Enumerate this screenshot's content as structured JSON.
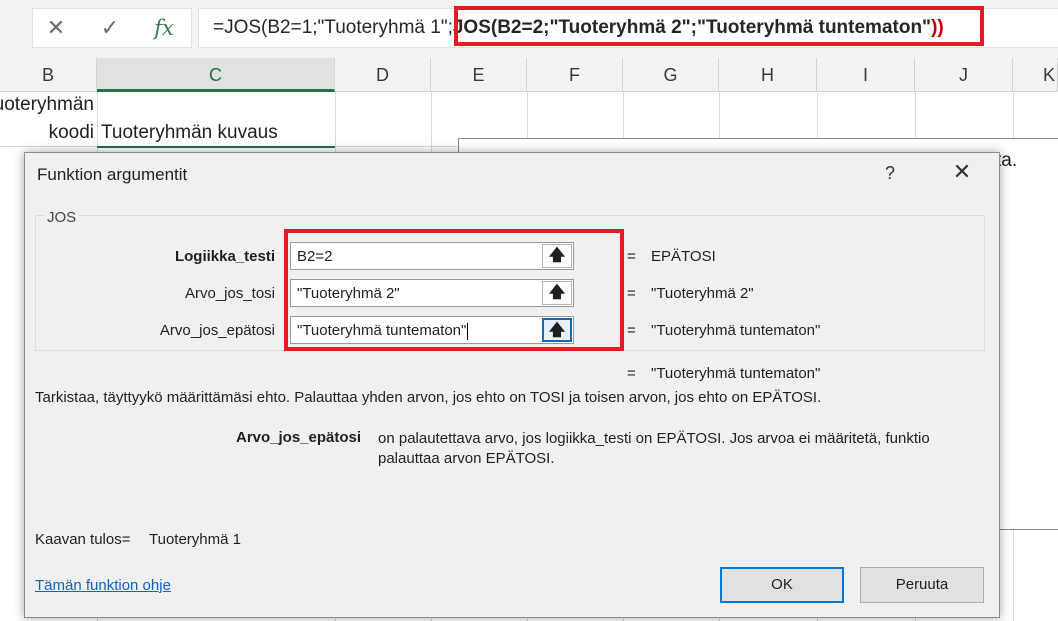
{
  "formula_bar": {
    "cancel_icon": "✕",
    "enter_icon": "✓",
    "fx_label": "fx",
    "formula_start": "=JOS(B2=1;\"Tuoteryhmä 1",
    "formula_highlight_prefix": "\";",
    "formula_highlight_bold": "JOS(B2=2;\"Tuoteryhmä 2\";\"Tuoteryhmä tuntematon\"",
    "formula_highlight_close": "))"
  },
  "sheet": {
    "columns": [
      "B",
      "C",
      "D",
      "E",
      "F",
      "G",
      "H",
      "I",
      "J",
      "K"
    ],
    "selected_column": "C",
    "cells": {
      "b1_line1": "Tuoteryhmän",
      "b1_line2": "koodi",
      "c1": "Tuoteryhmän kuvaus"
    },
    "textbox_fragment": "ta."
  },
  "dialog": {
    "title": "Funktion argumentit",
    "help_glyph": "?",
    "close_glyph": "✕",
    "function_name": "JOS",
    "args": [
      {
        "label": "Logiikka_testi",
        "value": "B2=2",
        "result": "EPÄTOSI"
      },
      {
        "label": "Arvo_jos_tosi",
        "value": "\"Tuoteryhmä 2\"",
        "result": "\"Tuoteryhmä 2\""
      },
      {
        "label": "Arvo_jos_epätosi",
        "value": "\"Tuoteryhmä tuntematon\"",
        "result": "\"Tuoteryhmä tuntematon\""
      }
    ],
    "ref_icon": "🡅",
    "equals": "=",
    "overall_result": "\"Tuoteryhmä tuntematon\"",
    "description": "Tarkistaa, täyttyykö määrittämäsi ehto. Palauttaa yhden arvon, jos ehto on TOSI ja toisen arvon, jos ehto on EPÄTOSI.",
    "param_name": "Arvo_jos_epätosi",
    "param_description": "on palautettava arvo, jos logiikka_testi on EPÄTOSI. Jos arvoa ei määritetä, funktio palauttaa arvon EPÄTOSI.",
    "formula_result_label": "Kaavan tulos=",
    "formula_result_value": "Tuoteryhmä 1",
    "help_link": "Tämän funktion ohje",
    "ok_label": "OK",
    "cancel_label": "Peruuta"
  }
}
